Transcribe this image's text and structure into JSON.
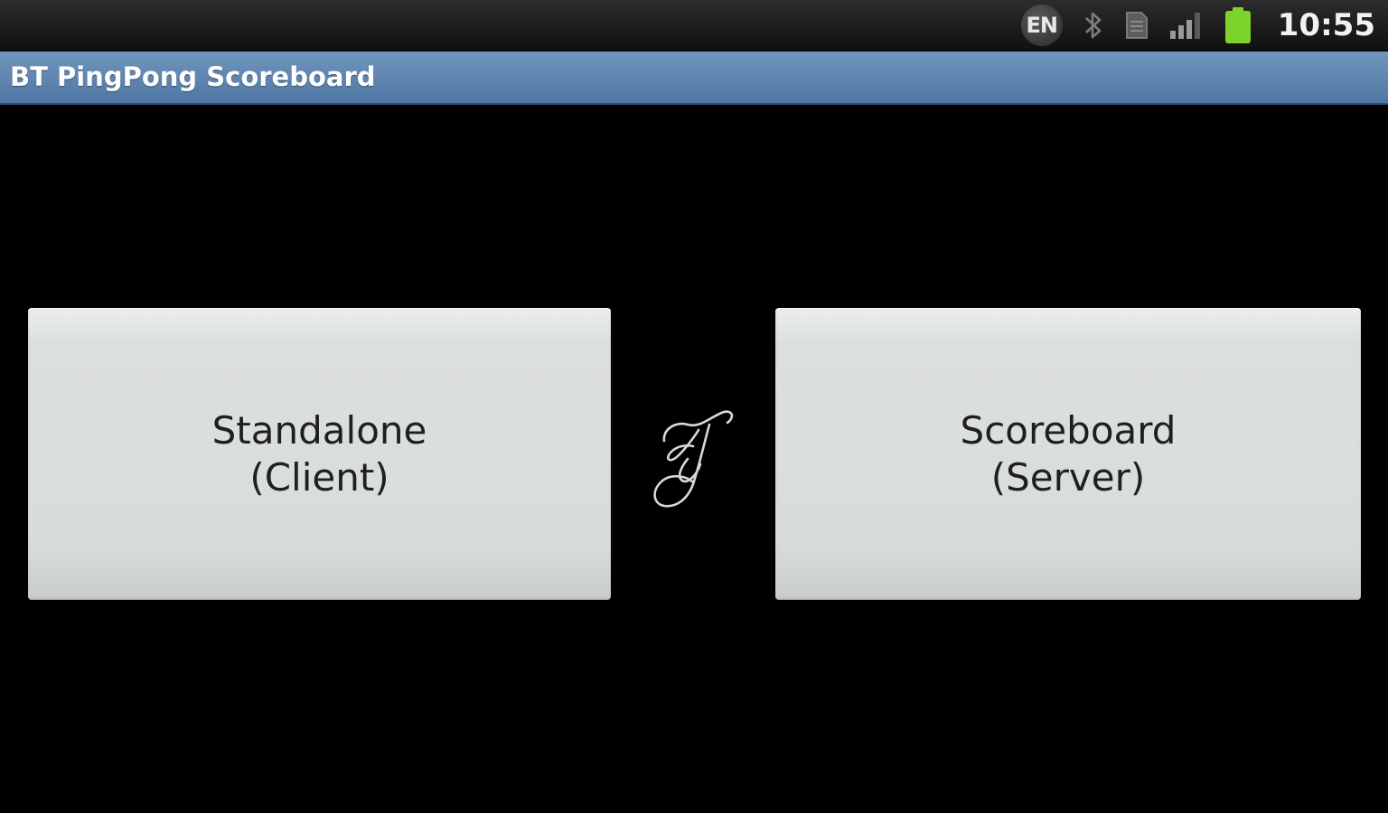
{
  "status_bar": {
    "language": "EN",
    "time": "10:55",
    "icons": [
      "language-icon",
      "bluetooth-icon",
      "sd-card-icon",
      "signal-icon",
      "battery-icon"
    ],
    "battery_color": "#7dd22c"
  },
  "app": {
    "title": "BT PingPong Scoreboard",
    "title_bar_color": "#5f86b1"
  },
  "buttons": {
    "standalone": {
      "line1": "Standalone",
      "line2": "(Client)"
    },
    "scoreboard": {
      "line1": "Scoreboard",
      "line2": "(Server)"
    }
  },
  "logo": {
    "icon": "g-monogram-logo-icon"
  }
}
